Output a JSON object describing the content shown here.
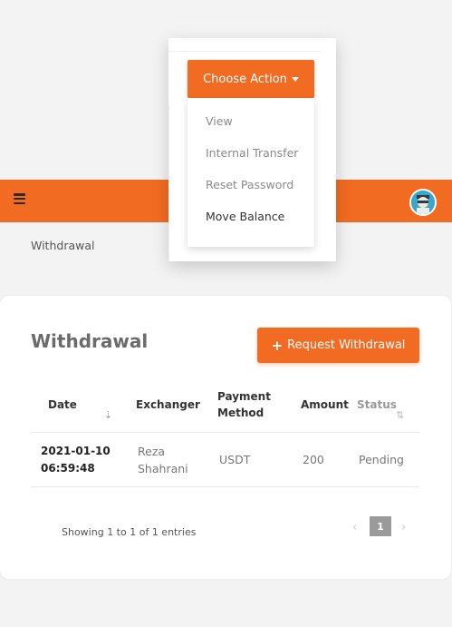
{
  "breadcrumb": "Withdrawal",
  "card": {
    "title": "Withdrawal",
    "request_button": "Request Withdrawal"
  },
  "table": {
    "columns": {
      "date": "Date",
      "exchanger": "Exchanger",
      "payment_method_line1": "Payment",
      "payment_method_line2": "Method",
      "amount": "Amount",
      "status": "Status"
    },
    "rows": [
      {
        "date_line1": "2021-01-10",
        "date_line2": "06:59:48",
        "exchanger_line1": "Reza",
        "exchanger_line2": "Shahrani",
        "payment_method": "USDT",
        "amount": "200",
        "status": "Pending"
      }
    ]
  },
  "pagination": {
    "info": "Showing 1 to 1 of 1 entries",
    "prev": "‹",
    "current": "1",
    "next": "›"
  },
  "dropdown": {
    "button": "Choose Action",
    "items": [
      "View",
      "Internal Transfer",
      "Reset Password",
      "Move Balance"
    ]
  },
  "colors": {
    "accent": "#f26b22",
    "page_bg": "#f3f3f3"
  },
  "icons": {
    "menu": "hamburger-icon",
    "sort_date": "sort-descending-icon",
    "sort_status": "sort-icon",
    "plus": "plus-icon",
    "avatar": "user-avatar"
  }
}
